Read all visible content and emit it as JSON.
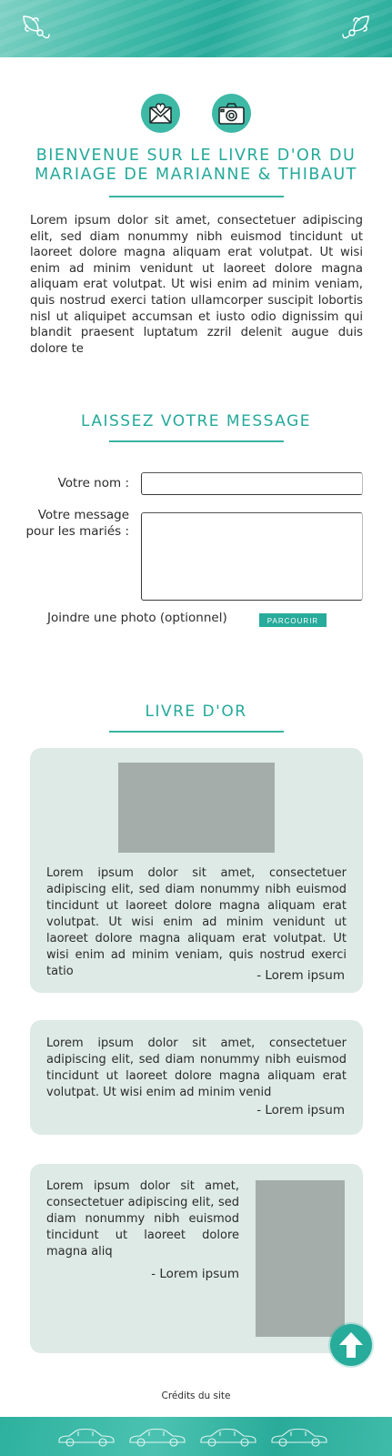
{
  "intro": {
    "title_line1": "BIENVENUE SUR LE LIVRE D'OR DU",
    "title_line2": "MARIAGE DE MARIANNE & THIBAUT",
    "icons": [
      "envelope-heart-icon",
      "camera-icon"
    ],
    "text": "Lorem ipsum dolor sit amet, consectetuer adipiscing elit, sed diam nonummy nibh euismod tincidunt ut laoreet dolore magna aliquam erat volutpat. Ut wisi enim ad minim venidunt ut laoreet dolore magna aliquam erat volutpat. Ut wisi enim ad minim veniam, quis nostrud exerci tation ullamcorper suscipit lobortis nisl ut aliquipet accumsan et iusto odio dignissim qui blandit praesent luptatum zzril delenit augue duis dolore te"
  },
  "form": {
    "title": "LAISSEZ VOTRE MESSAGE",
    "name_label": "Votre nom :",
    "name_value": "",
    "message_label_line1": "Votre message",
    "message_label_line2": "pour les mariés :",
    "message_value": "",
    "photo_label": "Joindre une photo (optionnel)",
    "browse_label": "PARCOURIR"
  },
  "guestbook": {
    "title": "LIVRE D'OR",
    "entries": [
      {
        "text": "Lorem ipsum dolor sit amet, consectetuer adipiscing elit, sed diam nonummy nibh euismod tincidunt ut laoreet dolore magna aliquam erat volutpat. Ut wisi enim ad minim venidunt ut laoreet dolore magna aliquam erat volutpat. Ut wisi enim ad minim veniam, quis nostrud exerci tatio",
        "author": "- Lorem ipsum"
      },
      {
        "text": "Lorem ipsum dolor sit amet, consectetuer adipiscing elit, sed diam nonummy nibh euismod tincidunt ut laoreet dolore magna aliquam erat volutpat. Ut wisi enim ad minim venid",
        "author": "- Lorem ipsum"
      },
      {
        "text": "Lorem ipsum dolor sit amet, consectetuer adipiscing elit, sed diam nonummy nibh euismod tincidunt ut laoreet dolore magna aliq",
        "author": "- Lorem ipsum"
      }
    ]
  },
  "footer": {
    "credits": "Crédits du site",
    "scroll_top_icon": "arrow-up-icon"
  },
  "colors": {
    "accent": "#27ab9b",
    "card_bg": "#deeae6",
    "image_placeholder": "#a4ada9"
  }
}
